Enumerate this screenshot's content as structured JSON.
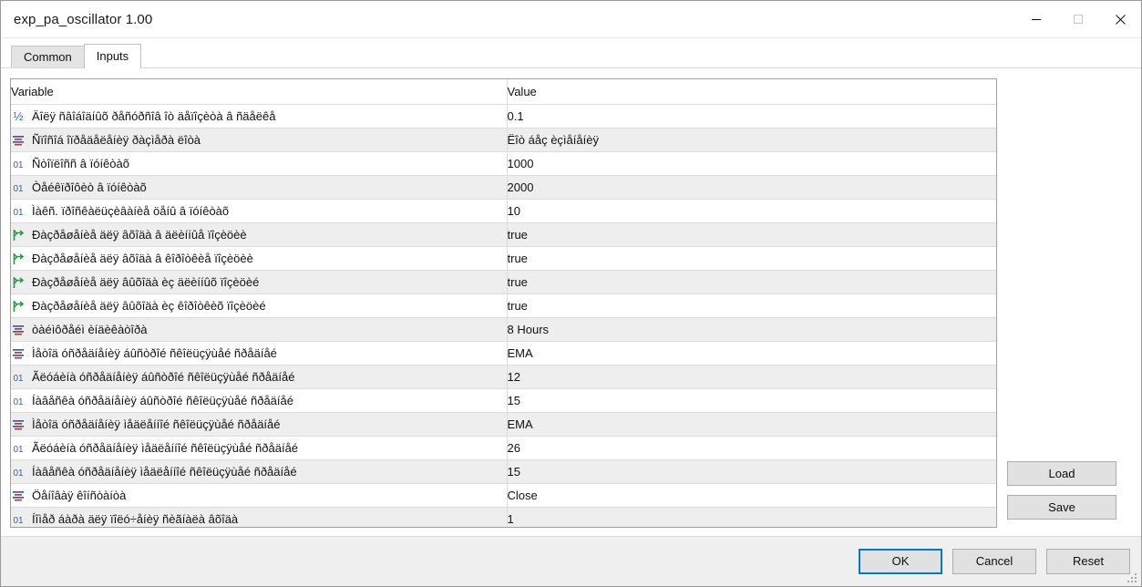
{
  "window": {
    "title": "exp_pa_oscillator 1.00",
    "controls": [
      {
        "name": "minimize",
        "glyph": "minimize-icon",
        "enabled": true
      },
      {
        "name": "maximize",
        "glyph": "maximize-icon",
        "enabled": false
      },
      {
        "name": "close",
        "glyph": "close-icon",
        "enabled": true
      }
    ]
  },
  "tabs": [
    {
      "label": "Common",
      "active": false
    },
    {
      "label": "Inputs",
      "active": true
    }
  ],
  "grid": {
    "headers": {
      "variable": "Variable",
      "value": "Value"
    },
    "rows": [
      {
        "icon": "fraction-double-icon",
        "variable": "Äîëÿ ñâîáîäíûõ ðåñóðñîâ îò äåïîçèòà â ñäåëêå",
        "value": "0.1"
      },
      {
        "icon": "enum-list-icon",
        "variable": "Ñïîñîá îïðåäåëåíèÿ ðàçìåðà ëîòà",
        "value": "Ëîò áåç èçìåíåíèÿ"
      },
      {
        "icon": "integer-icon",
        "variable": "Ñòîïëîññ â ïóíêòàõ",
        "value": "1000"
      },
      {
        "icon": "integer-icon",
        "variable": "Òåéêïðîôèò â ïóíêòàõ",
        "value": "2000"
      },
      {
        "icon": "integer-icon",
        "variable": "Ìàêñ. ïðîñêàëüçèâàíèå öåíû â ïóíêòàõ",
        "value": "10"
      },
      {
        "icon": "bool-flag-icon",
        "variable": "Ðàçðåøåíèå äëÿ âõîäà â äëèííûå ïîçèöèè",
        "value": "true"
      },
      {
        "icon": "bool-flag-icon",
        "variable": "Ðàçðåøåíèå äëÿ âõîäà â êîðîòêèå ïîçèöèè",
        "value": "true"
      },
      {
        "icon": "bool-flag-icon",
        "variable": "Ðàçðåøåíèå äëÿ âûõîäà èç äëèííûõ ïîçèöèé",
        "value": "true"
      },
      {
        "icon": "bool-flag-icon",
        "variable": "Ðàçðåøåíèå äëÿ âûõîäà èç êîðîòêèõ ïîçèöèé",
        "value": "true"
      },
      {
        "icon": "enum-list-icon",
        "variable": "òàéìôðåéì èíäèêàòîðà",
        "value": "8 Hours"
      },
      {
        "icon": "enum-list-icon",
        "variable": "Ìåòîä óñðåäíåíèÿ áûñòðîé ñêîëüçÿùåé ñðåäíåé",
        "value": "EMA"
      },
      {
        "icon": "integer-icon",
        "variable": "Ãëóáèíà óñðåäíåíèÿ áûñòðîé ñêîëüçÿùåé ñðåäíåé",
        "value": "12"
      },
      {
        "icon": "integer-icon",
        "variable": "Íàâåñêà óñðåäíåíèÿ áûñòðîé ñêîëüçÿùåé ñðåäíåé",
        "value": "15"
      },
      {
        "icon": "enum-list-icon",
        "variable": "Ìåòîä óñðåäíåíèÿ ìåäëåííîé ñêîëüçÿùåé ñðåäíåé",
        "value": "EMA"
      },
      {
        "icon": "integer-icon",
        "variable": "Ãëóáèíà óñðåäíåíèÿ ìåäëåííîé ñêîëüçÿùåé ñðåäíåé",
        "value": "26"
      },
      {
        "icon": "integer-icon",
        "variable": "Íàâåñêà óñðåäíåíèÿ ìåäëåííîé ñêîëüçÿùåé ñðåäíåé",
        "value": "15"
      },
      {
        "icon": "enum-list-icon",
        "variable": "Öåíîâàÿ êîíñòàíòà",
        "value": "Close"
      },
      {
        "icon": "integer-icon",
        "variable": "Íîìåð áàðà äëÿ ïîëó÷åíèÿ ñèãíàëà âõîäà",
        "value": "1"
      }
    ]
  },
  "side_buttons": [
    {
      "label": "Load"
    },
    {
      "label": "Save"
    }
  ],
  "footer_buttons": [
    {
      "label": "OK",
      "default": true
    },
    {
      "label": "Cancel",
      "default": false
    },
    {
      "label": "Reset",
      "default": false
    }
  ],
  "colors": {
    "accent": "#0078d7",
    "row_alt": "#eeeeee",
    "button_face": "#e1e1e1",
    "icon_int": "#2a62b6",
    "icon_bool": "#1f9d45",
    "icon_enum_blue": "#2a62b6",
    "icon_enum_red": "#c0392b"
  }
}
